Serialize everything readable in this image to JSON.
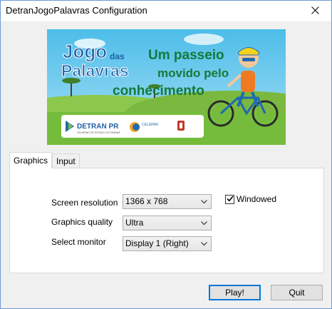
{
  "window": {
    "title": "DetranJogoPalavras Configuration"
  },
  "banner": {
    "game_title_line1": "Jogo",
    "game_title_das": "das",
    "game_title_line2": "Palavras",
    "slogan_line1": "Um passeio",
    "slogan_line2": "movido pelo",
    "slogan_line3": "conhecimento",
    "logo_detran": "DETRAN PR",
    "logo_detran_sub": "GOVERNO DO ESTADO DO PARANÁ",
    "logo_celepar": "CELEPAR",
    "colors": {
      "sky": "#5fc6ec",
      "grass": "#7ac043",
      "title_blue": "#1e5fa6",
      "slogan_green": "#157a3a"
    }
  },
  "tabs": [
    {
      "label": "Graphics",
      "active": true
    },
    {
      "label": "Input",
      "active": false
    }
  ],
  "graphics": {
    "screen_resolution_label": "Screen resolution",
    "screen_resolution_value": "1366 x 768",
    "graphics_quality_label": "Graphics quality",
    "graphics_quality_value": "Ultra",
    "select_monitor_label": "Select monitor",
    "select_monitor_value": "Display 1 (Right)",
    "windowed_label": "Windowed",
    "windowed_checked": true
  },
  "buttons": {
    "play_label": "Play!",
    "quit_label": "Quit"
  },
  "icons": {
    "close": "close-icon",
    "dropdown": "chevron-down-icon",
    "check": "checkmark-icon"
  }
}
